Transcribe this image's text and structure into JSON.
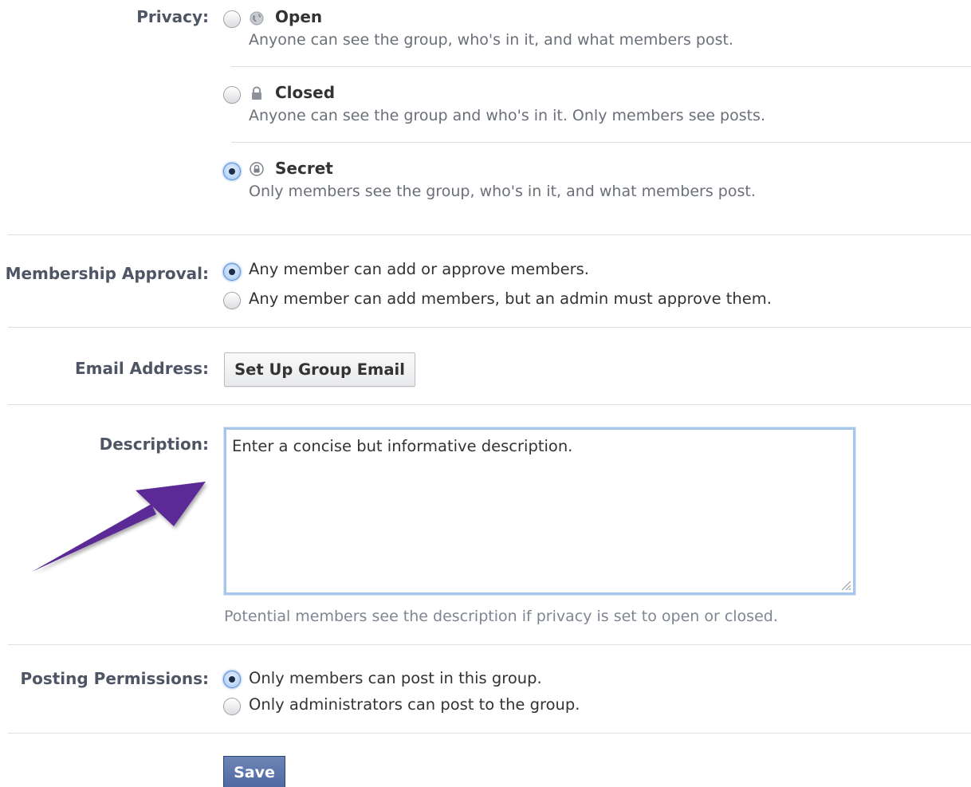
{
  "privacy": {
    "label": "Privacy:",
    "options": [
      {
        "title": "Open",
        "description": "Anyone can see the group, who's in it, and what members post.",
        "icon": "globe-icon",
        "selected": false
      },
      {
        "title": "Closed",
        "description": "Anyone can see the group and who's in it. Only members see posts.",
        "icon": "lock-icon",
        "selected": false
      },
      {
        "title": "Secret",
        "description": "Only members see the group, who's in it, and what members post.",
        "icon": "secret-lock-icon",
        "selected": true
      }
    ]
  },
  "membership": {
    "label": "Membership Approval:",
    "options": [
      {
        "text": "Any member can add or approve members.",
        "selected": true
      },
      {
        "text": "Any member can add members, but an admin must approve them.",
        "selected": false
      }
    ]
  },
  "email": {
    "label": "Email Address:",
    "button_label": "Set Up Group Email"
  },
  "description": {
    "label": "Description:",
    "value": "Enter a concise but informative description.",
    "help_text": "Potential members see the description if privacy is set to open or closed."
  },
  "posting": {
    "label": "Posting Permissions:",
    "options": [
      {
        "text": "Only members can post in this group.",
        "selected": true
      },
      {
        "text": "Only administrators can post to the group.",
        "selected": false
      }
    ]
  },
  "save_label": "Save",
  "colors": {
    "label": "#4e5665",
    "divider": "#dddfe2",
    "save_button": "#5b74a8",
    "focus_border": "#a7c6ea",
    "annotation_arrow": "#5b2a96"
  }
}
